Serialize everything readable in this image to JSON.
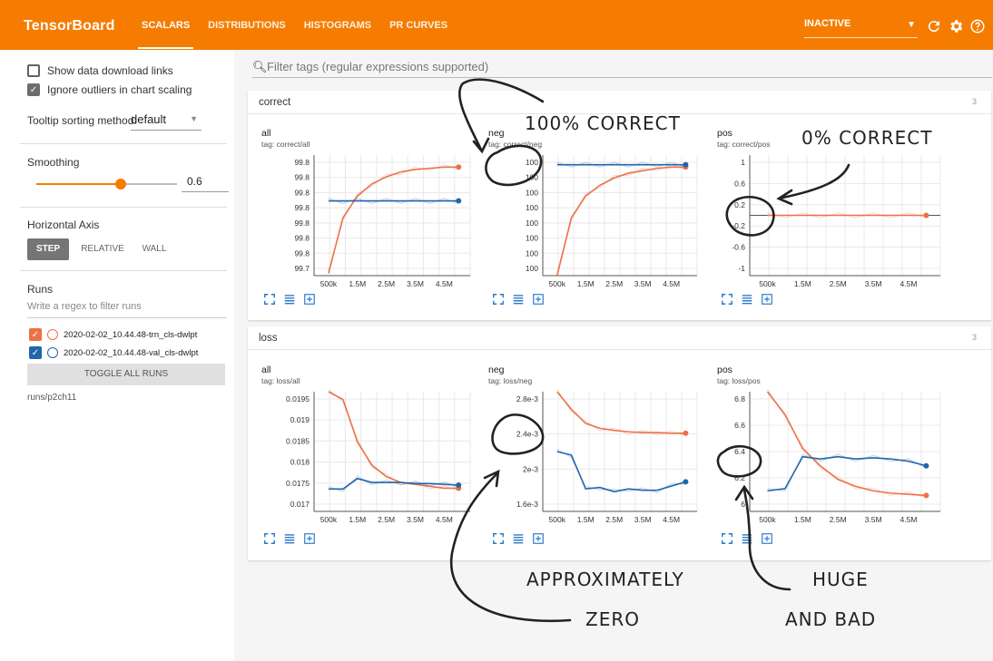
{
  "header": {
    "brand": "TensorBoard",
    "tabs": [
      {
        "label": "SCALARS",
        "active": true
      },
      {
        "label": "DISTRIBUTIONS",
        "active": false
      },
      {
        "label": "HISTOGRAMS",
        "active": false
      },
      {
        "label": "PR CURVES",
        "active": false
      }
    ],
    "status": "INACTIVE",
    "icons": [
      "caret-down-icon",
      "refresh-icon",
      "gear-icon",
      "help-icon"
    ],
    "accent_color": "#f57c00"
  },
  "sidebar": {
    "show_download_links": {
      "label": "Show data download links",
      "checked": false
    },
    "ignore_outliers": {
      "label": "Ignore outliers in chart scaling",
      "checked": true
    },
    "tooltip_sorting": {
      "label": "Tooltip sorting method:",
      "value": "default"
    },
    "smoothing": {
      "label": "Smoothing",
      "value": "0.6",
      "fraction": 0.6
    },
    "horizontal_axis": {
      "label": "Horizontal Axis",
      "options": [
        "STEP",
        "RELATIVE",
        "WALL"
      ],
      "selected": "STEP"
    },
    "runs": {
      "label": "Runs",
      "filter_placeholder": "Write a regex to filter runs",
      "items": [
        {
          "name": "2020-02-02_10.44.48-trn_cls-dwlpt",
          "checked": true,
          "color": "#ec7148"
        },
        {
          "name": "2020-02-02_10.44.48-val_cls-dwlpt",
          "checked": true,
          "color": "#2166ac"
        }
      ],
      "toggle_label": "TOGGLE ALL RUNS",
      "path": "runs/p2ch11"
    }
  },
  "main": {
    "search_placeholder": "Filter tags (regular expressions supported)",
    "groups": [
      {
        "name": "correct",
        "count": "3"
      },
      {
        "name": "loss",
        "count": "3"
      }
    ],
    "cards": [
      {
        "title": "all",
        "tag": "tag: correct/all"
      },
      {
        "title": "neg",
        "tag": "tag: correct/neg"
      },
      {
        "title": "pos",
        "tag": "tag: correct/pos"
      },
      {
        "title": "all",
        "tag": "tag: loss/all"
      },
      {
        "title": "neg",
        "tag": "tag: loss/neg"
      },
      {
        "title": "pos",
        "tag": "tag: loss/pos"
      }
    ]
  },
  "annotations": {
    "c1": "100% CORRECT",
    "c2": "0% CORRECT",
    "c3a": "APPROXIMATELY",
    "c3b": "ZERO",
    "c4a": "HUGE",
    "c4b": "AND BAD"
  },
  "chart_data": [
    {
      "type": "line",
      "title": "all",
      "x_ticks": [
        "500k",
        "1.5M",
        "2.5M",
        "3.5M",
        "4.5M"
      ],
      "y_ticks": [
        "99.8",
        "99.8",
        "99.8",
        "99.8",
        "99.8",
        "99.8",
        "99.8",
        "99.7"
      ],
      "x": [
        500000,
        1000000,
        1500000,
        2000000,
        2500000,
        3000000,
        3500000,
        4000000,
        4500000,
        5000000
      ],
      "series": [
        {
          "color": "#ec7148",
          "values": [
            0.02,
            0.48,
            0.66,
            0.76,
            0.82,
            0.86,
            0.88,
            0.89,
            0.9,
            0.9
          ]
        },
        {
          "color": "#2166ac",
          "values": [
            0.62,
            0.62,
            0.62,
            0.62,
            0.62,
            0.62,
            0.62,
            0.62,
            0.62,
            0.62
          ]
        }
      ]
    },
    {
      "type": "line",
      "title": "neg",
      "x_ticks": [
        "500k",
        "1.5M",
        "2.5M",
        "3.5M",
        "4.5M"
      ],
      "y_ticks": [
        "100",
        "100",
        "100",
        "100",
        "100",
        "100",
        "100",
        "100"
      ],
      "x": [
        500000,
        1000000,
        1500000,
        2000000,
        2500000,
        3000000,
        3500000,
        4000000,
        4500000,
        5000000
      ],
      "series": [
        {
          "color": "#ec7148",
          "values": [
            0.0,
            0.48,
            0.66,
            0.75,
            0.81,
            0.85,
            0.87,
            0.89,
            0.9,
            0.9
          ]
        },
        {
          "color": "#2166ac",
          "values": [
            0.92,
            0.92,
            0.92,
            0.92,
            0.92,
            0.92,
            0.92,
            0.92,
            0.92,
            0.92
          ]
        }
      ]
    },
    {
      "type": "line",
      "title": "pos",
      "x_ticks": [
        "500k",
        "1.5M",
        "2.5M",
        "3.5M",
        "4.5M"
      ],
      "y_ticks": [
        "1",
        "0.6",
        "0.2",
        "-0.2",
        "-0.6",
        "-1"
      ],
      "ylim": [
        -1.2,
        1.2
      ],
      "x": [
        500000,
        1000000,
        1500000,
        2000000,
        2500000,
        3000000,
        3500000,
        4000000,
        4500000,
        5000000
      ],
      "series": [
        {
          "color": "#ec7148",
          "values": [
            0,
            0,
            0,
            0,
            0,
            0,
            0,
            0,
            0,
            0
          ]
        }
      ]
    },
    {
      "type": "line",
      "title": "all",
      "x_ticks": [
        "500k",
        "1.5M",
        "2.5M",
        "3.5M",
        "4.5M"
      ],
      "y_ticks": [
        "0.0195",
        "0.019",
        "0.0185",
        "0.018",
        "0.0175",
        "0.017"
      ],
      "ylim": [
        0.0167,
        0.0198
      ],
      "x": [
        500000,
        1000000,
        1500000,
        2000000,
        2500000,
        3000000,
        3500000,
        4000000,
        4500000,
        5000000
      ],
      "series": [
        {
          "color": "#ec7148",
          "values": [
            0.0198,
            0.0196,
            0.0185,
            0.0179,
            0.0176,
            0.01745,
            0.0174,
            0.01735,
            0.0173,
            0.0173
          ]
        },
        {
          "color": "#2166ac",
          "values": [
            0.01728,
            0.01728,
            0.01755,
            0.01745,
            0.01745,
            0.01745,
            0.01742,
            0.01742,
            0.0174,
            0.01738
          ]
        }
      ]
    },
    {
      "type": "line",
      "title": "neg",
      "x_ticks": [
        "500k",
        "1.5M",
        "2.5M",
        "3.5M",
        "4.5M"
      ],
      "y_ticks": [
        "2.8e-3",
        "2.4e-3",
        "2e-3",
        "1.6e-3"
      ],
      "ylim": [
        0.0014,
        0.0031
      ],
      "x": [
        500000,
        1000000,
        1500000,
        2000000,
        2500000,
        3000000,
        3500000,
        4000000,
        4500000,
        5000000
      ],
      "series": [
        {
          "color": "#ec7148",
          "values": [
            0.0031,
            0.00285,
            0.00265,
            0.00258,
            0.00255,
            0.00253,
            0.00252,
            0.00252,
            0.00251,
            0.00251
          ]
        },
        {
          "color": "#2166ac",
          "values": [
            0.00225,
            0.0022,
            0.00172,
            0.00174,
            0.00168,
            0.00172,
            0.0017,
            0.0017,
            0.00176,
            0.00182
          ]
        }
      ]
    },
    {
      "type": "line",
      "title": "pos",
      "x_ticks": [
        "500k",
        "1.5M",
        "2.5M",
        "3.5M",
        "4.5M"
      ],
      "y_ticks": [
        "6.8",
        "6.6",
        "6.4",
        "6.2",
        "6"
      ],
      "ylim": [
        5.9,
        6.95
      ],
      "x": [
        500000,
        1000000,
        1500000,
        2000000,
        2500000,
        3000000,
        3500000,
        4000000,
        4500000,
        5000000
      ],
      "series": [
        {
          "color": "#ec7148",
          "values": [
            6.95,
            6.75,
            6.45,
            6.3,
            6.18,
            6.12,
            6.08,
            6.06,
            6.05,
            6.04
          ]
        },
        {
          "color": "#2166ac",
          "values": [
            6.08,
            6.1,
            6.38,
            6.36,
            6.38,
            6.36,
            6.37,
            6.36,
            6.34,
            6.3
          ]
        }
      ]
    }
  ]
}
